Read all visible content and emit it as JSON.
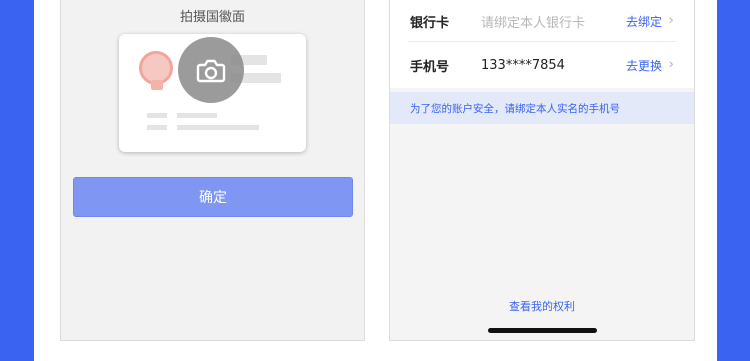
{
  "left_screen": {
    "emblem_title": "拍摄国徽面",
    "confirm_button": "确定"
  },
  "right_screen": {
    "rows": [
      {
        "label": "银行卡",
        "value": "请绑定本人银行卡",
        "value_is_placeholder": true,
        "action": "去绑定"
      },
      {
        "label": "手机号",
        "value": "133****7854",
        "value_is_placeholder": false,
        "action": "去更换"
      }
    ],
    "tip": "为了您的账户安全，请绑定本人实名的手机号",
    "rights_link": "查看我的权利"
  },
  "colors": {
    "accent": "#3a63f2",
    "confirm_button_bg": "#7f97f3",
    "tip_bg": "#e3e9f8"
  },
  "icons": [
    "camera-icon",
    "chevron-right-icon",
    "national-emblem-icon"
  ]
}
